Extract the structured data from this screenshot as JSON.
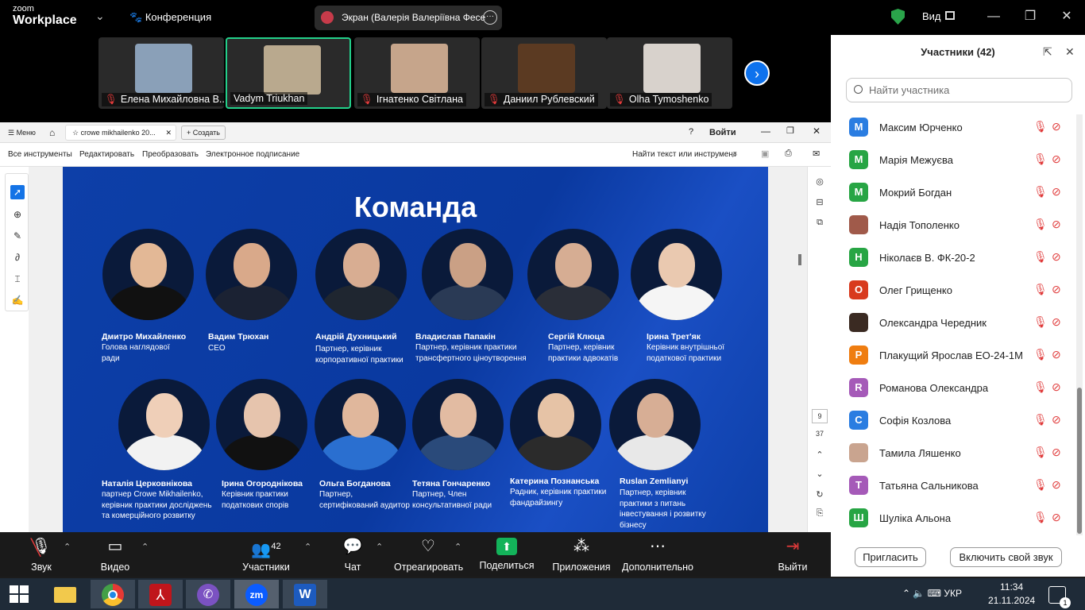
{
  "topbar": {
    "logo_line1": "zoom",
    "logo_line2": "Workplace",
    "meeting_label": "Конференция",
    "share_pill": "Экран (Валерія Валеріївна Фесе",
    "view_label": "Вид"
  },
  "thumbnails": [
    {
      "name": "Елена Михайловна В...",
      "muted": true,
      "bg": "#8aa0b8"
    },
    {
      "name": "Vadym Triukhan",
      "muted": false,
      "bg": "#b9a98e",
      "active": true
    },
    {
      "name": "Ігнатенко Світлана",
      "muted": true,
      "bg": "#c6a58b"
    },
    {
      "name": "Даниил Рублевский",
      "muted": true,
      "bg": "#5b3a22"
    },
    {
      "name": "Olha Tymoshenko",
      "muted": true,
      "bg": "#d8d2cc"
    }
  ],
  "acrobat": {
    "menu": "Меню",
    "tab_title": "crowe mikhailenko 20...",
    "create": "Создать",
    "signin": "Войти",
    "tools": [
      "Все инструменты",
      "Редактировать",
      "Преобразовать",
      "Электронное подписание"
    ],
    "find": "Найти текст или инструмент",
    "page_current": "9",
    "page_total": "37"
  },
  "slide": {
    "title": "Команда",
    "row1": [
      {
        "name": "Дмитро Михайленко",
        "role": "Голова наглядової ради",
        "skin": "#e3b896",
        "suit": "#111"
      },
      {
        "name": "Вадим Трюхан",
        "role": "CEO",
        "skin": "#d9a98a",
        "suit": "#1b2233"
      },
      {
        "name": "Андрій Духницький",
        "role": "Партнер, керівник корпоративної практики",
        "skin": "#d8ad92",
        "suit": "#1f2630"
      },
      {
        "name": "Владислав Папакін",
        "role": "Партнер, керівник практики трансфертного ціноутворення",
        "skin": "#caa085",
        "suit": "#2a3a55"
      },
      {
        "name": "Сергій Клюца",
        "role": "Партнер, керівник практики адвокатів",
        "skin": "#d6ad93",
        "suit": "#2a2e38"
      },
      {
        "name": "Ірина Трет'як",
        "role": "Керівник внутрішньої податкової практики",
        "skin": "#eac9b0",
        "suit": "#f5f5f5"
      }
    ],
    "row2": [
      {
        "name": "Наталія Церковнікова",
        "role": "партнер Crowe Mikhailenko, керівник практики досліджень та комерційного розвитку",
        "skin": "#efcfb8",
        "suit": "#f2f2f2"
      },
      {
        "name": "Ірина Огороднікова",
        "role": "Керівник практики податкових спорів",
        "skin": "#e6c4ad",
        "suit": "#111"
      },
      {
        "name": "Ольга Богданова",
        "role": "Партнер, сертифікований аудитор",
        "skin": "#e0b79c",
        "suit": "#2a6fd0"
      },
      {
        "name": "Тетяна Гончаренко",
        "role": "Партнер, Член консультативної ради",
        "skin": "#e2bba2",
        "suit": "#2a4a7a"
      },
      {
        "name": "Катерина Познанська",
        "role": "Радник, керівник практики фандрайзингу",
        "skin": "#e6c3a6",
        "suit": "#2b2b2b"
      },
      {
        "name": "Ruslan Zemlianyi",
        "role": "Партнер, керівник практики з питань інвестування і розвитку бізнесу",
        "skin": "#d7ae95",
        "suit": "#e8e8e8"
      }
    ]
  },
  "panel": {
    "title": "Участники (42)",
    "search_placeholder": "Найти участника",
    "invite": "Пригласить",
    "unmute": "Включить свой звук",
    "participants": [
      {
        "initial": "M",
        "name": "Максим Юрченко",
        "color": "#2a7de1"
      },
      {
        "initial": "M",
        "name": "Марія Межуєва",
        "color": "#27a544"
      },
      {
        "initial": "M",
        "name": "Мокрий Богдан",
        "color": "#27a544"
      },
      {
        "initial": "",
        "name": "Надія Тополенко",
        "color": "#a05a4a"
      },
      {
        "initial": "Н",
        "name": "Ніколаєв В. ФК-20-2",
        "color": "#27a544"
      },
      {
        "initial": "O",
        "name": "Олег Грищенко",
        "color": "#d83a1e"
      },
      {
        "initial": "",
        "name": "Олександра Чередник",
        "color": "#3a2a22"
      },
      {
        "initial": "Р",
        "name": "Плакущий Ярослав ЕО-24-1М",
        "color": "#ef7d10"
      },
      {
        "initial": "R",
        "name": "Романова Олександра",
        "color": "#a55ab8"
      },
      {
        "initial": "С",
        "name": "Софія Козлова",
        "color": "#2a7de1"
      },
      {
        "initial": "",
        "name": "Тамила Ляшенко",
        "color": "#c9a48f"
      },
      {
        "initial": "Т",
        "name": "Татьяна Сальникова",
        "color": "#a55ab8"
      },
      {
        "initial": "Ш",
        "name": "Шуліка Альона",
        "color": "#27a544"
      }
    ]
  },
  "toolbar": {
    "sound": "Звук",
    "video": "Видео",
    "participants": "Участники",
    "participants_count": "42",
    "chat": "Чат",
    "react": "Отреагировать",
    "share": "Поделиться",
    "apps": "Приложения",
    "more": "Дополнительно",
    "leave": "Выйти"
  },
  "taskbar": {
    "lang": "УКР",
    "time": "11:34",
    "date": "21.11.2024",
    "notifications": "1"
  }
}
